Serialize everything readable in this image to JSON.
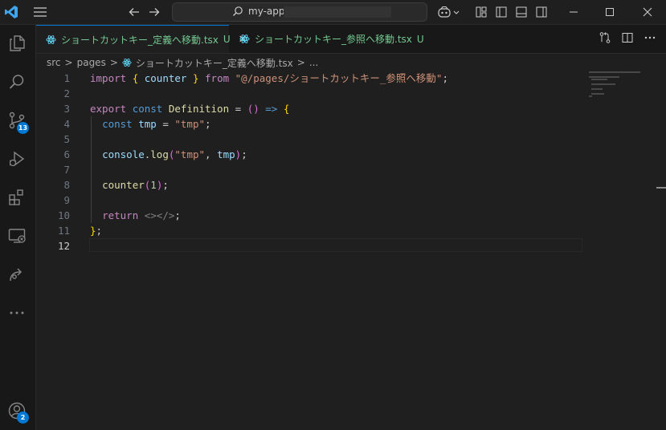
{
  "titlebar": {
    "search_text": "my-app"
  },
  "activity_bar": {
    "source_control_badge": "13",
    "accounts_badge": "2"
  },
  "tabs": [
    {
      "label": "ショートカットキー_定義へ移動.tsx",
      "status": "U",
      "close": "✕"
    },
    {
      "label": "ショートカットキー_参照へ移動.tsx",
      "status": "U"
    }
  ],
  "breadcrumb": {
    "items": [
      "src",
      "pages",
      "ショートカットキー_定義へ移動.tsx",
      "..."
    ],
    "separator": ">"
  },
  "editor": {
    "current_line": 12,
    "lines": [
      {
        "n": "1",
        "t": [
          [
            "kw",
            "import "
          ],
          [
            "br1",
            "{ "
          ],
          [
            "vr",
            "counter"
          ],
          [
            "br1",
            " }"
          ],
          [
            "kw",
            " from "
          ],
          [
            "st",
            "\"@/pages/ショートカットキー_参照へ移動\""
          ],
          [
            "pn",
            ";"
          ]
        ]
      },
      {
        "n": "2",
        "t": []
      },
      {
        "n": "3",
        "t": [
          [
            "kw",
            "export "
          ],
          [
            "kb",
            "const "
          ],
          [
            "fn",
            "Definition"
          ],
          [
            "pn",
            " = "
          ],
          [
            "br2",
            "()"
          ],
          [
            "pn",
            " "
          ],
          [
            "kb",
            "=>"
          ],
          [
            "pn",
            " "
          ],
          [
            "br1",
            "{"
          ]
        ]
      },
      {
        "n": "4",
        "t": [
          [
            "pn",
            "  "
          ],
          [
            "kb",
            "const "
          ],
          [
            "vr",
            "tmp"
          ],
          [
            "pn",
            " = "
          ],
          [
            "st",
            "\"tmp\""
          ],
          [
            "pn",
            ";"
          ]
        ]
      },
      {
        "n": "5",
        "t": []
      },
      {
        "n": "6",
        "t": [
          [
            "pn",
            "  "
          ],
          [
            "vr",
            "console"
          ],
          [
            "pn",
            "."
          ],
          [
            "fn",
            "log"
          ],
          [
            "br2",
            "("
          ],
          [
            "st",
            "\"tmp\""
          ],
          [
            "pn",
            ", "
          ],
          [
            "vr",
            "tmp"
          ],
          [
            "br2",
            ")"
          ],
          [
            "pn",
            ";"
          ]
        ]
      },
      {
        "n": "7",
        "t": []
      },
      {
        "n": "8",
        "t": [
          [
            "pn",
            "  "
          ],
          [
            "fn",
            "counter"
          ],
          [
            "br2",
            "("
          ],
          [
            "nm",
            "1"
          ],
          [
            "br2",
            ")"
          ],
          [
            "pn",
            ";"
          ]
        ]
      },
      {
        "n": "9",
        "t": []
      },
      {
        "n": "10",
        "t": [
          [
            "pn",
            "  "
          ],
          [
            "kw",
            "return "
          ],
          [
            "gy",
            "<></>"
          ],
          [
            "pn",
            ";"
          ]
        ]
      },
      {
        "n": "11",
        "t": [
          [
            "br1",
            "}"
          ],
          [
            "pn",
            ";"
          ]
        ]
      },
      {
        "n": "12",
        "t": []
      }
    ]
  },
  "colors": {
    "accent": "#0078d4",
    "untracked_file": "#73c991",
    "background": "#1f1f1f"
  }
}
